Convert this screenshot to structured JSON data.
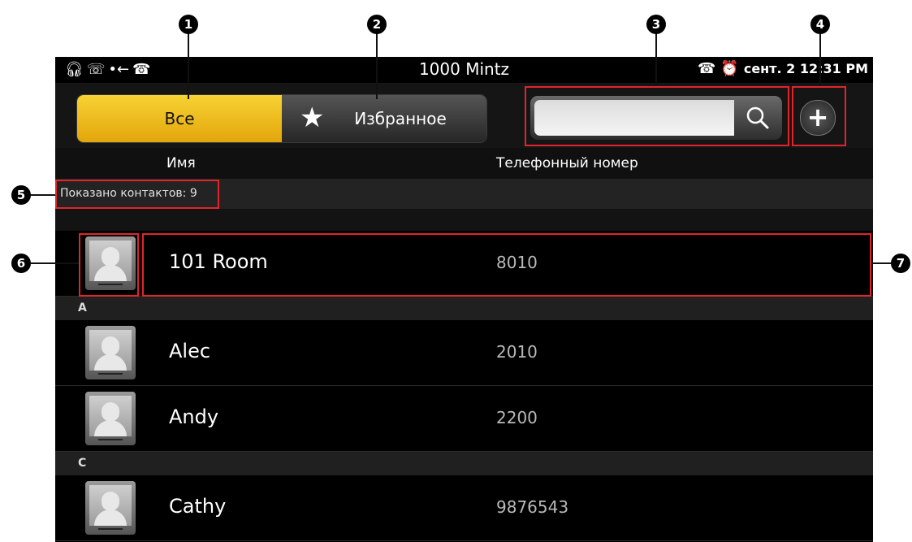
{
  "status_bar": {
    "title": "1000  Mintz",
    "time": "сент. 2 12:31 PM",
    "left_icons": [
      "headset-icon",
      "voicemail-icon",
      "call-forward-icon",
      "phone-icon"
    ],
    "right_icons": [
      "phone-hook-icon",
      "alarm-icon"
    ]
  },
  "tabs": {
    "all_label": "Все",
    "favorites_label": "Избранное",
    "favorites_icon": "★"
  },
  "search": {
    "placeholder": "",
    "value": ""
  },
  "add_button": {
    "label": "+"
  },
  "columns": {
    "name": "Имя",
    "phone": "Телефонный номер"
  },
  "count_text": "Показано контактов: 9",
  "contacts": [
    {
      "name": "101 Room",
      "phone": "8010"
    },
    {
      "name": "Alec",
      "phone": "2010"
    },
    {
      "name": "Andy",
      "phone": "2200"
    },
    {
      "name": "Cathy",
      "phone": "9876543"
    }
  ],
  "sections": [
    "A",
    "C"
  ],
  "callouts": [
    "1",
    "2",
    "3",
    "4",
    "5",
    "6",
    "7"
  ],
  "colors": {
    "accent": "#F2C12E",
    "highlight": "#E0252B",
    "background": "#000000"
  }
}
